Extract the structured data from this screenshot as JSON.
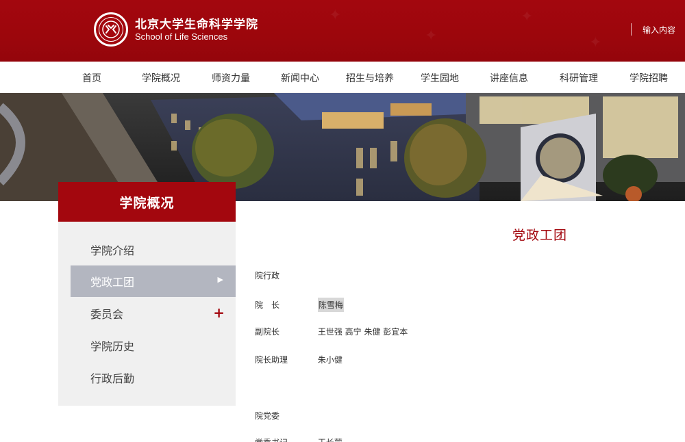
{
  "header": {
    "school_cn": "北京大学生命科学学院",
    "school_en": "School of Life Sciences",
    "search_label": "输入内容",
    "brand_color": "#a3070e"
  },
  "nav": {
    "items": [
      {
        "label": "首页"
      },
      {
        "label": "学院概况"
      },
      {
        "label": "师资力量"
      },
      {
        "label": "新闻中心"
      },
      {
        "label": "招生与培养"
      },
      {
        "label": "学生园地"
      },
      {
        "label": "讲座信息"
      },
      {
        "label": "科研管理"
      },
      {
        "label": "学院招聘"
      }
    ]
  },
  "sidebar": {
    "title": "学院概况",
    "items": [
      {
        "label": "学院介绍",
        "active": false
      },
      {
        "label": "党政工团",
        "active": true,
        "icon": "chevron-right-icon"
      },
      {
        "label": "委员会",
        "active": false,
        "icon": "plus-icon"
      },
      {
        "label": "学院历史",
        "active": false
      },
      {
        "label": "行政后勤",
        "active": false
      }
    ]
  },
  "content": {
    "title": "党政工团",
    "sections": [
      {
        "heading": "院行政",
        "rows": [
          {
            "role": "院　长",
            "names": "陈雪梅"
          },
          {
            "role": "副院长",
            "names": "王世强  高宁 朱健 彭宜本"
          },
          {
            "role": "院长助理",
            "names": "朱小健"
          }
        ]
      },
      {
        "heading": "院党委",
        "rows": [
          {
            "role": "党委书记",
            "names": "王长蒙"
          }
        ]
      }
    ]
  }
}
